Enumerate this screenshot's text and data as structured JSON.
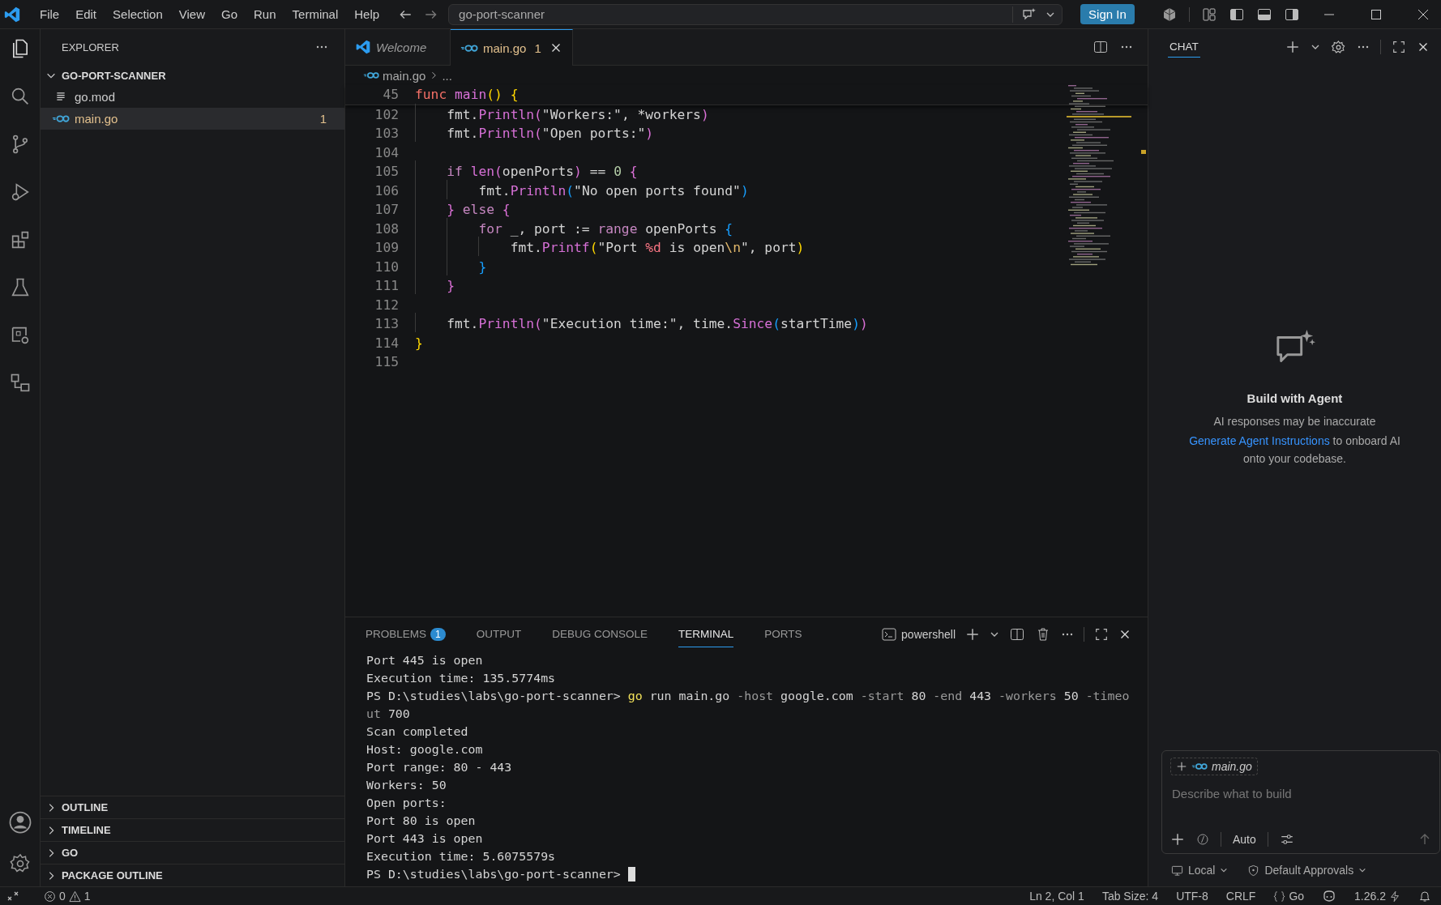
{
  "menu": [
    "File",
    "Edit",
    "Selection",
    "View",
    "Go",
    "Run",
    "Terminal",
    "Help"
  ],
  "search": {
    "value": "go-port-scanner"
  },
  "sign_in": "Sign In",
  "explorer": {
    "title": "EXPLORER",
    "folder": "GO-PORT-SCANNER",
    "expanded": true,
    "files": [
      {
        "name": "go.mod",
        "kind": "mod",
        "selected": false,
        "warning": false
      },
      {
        "name": "main.go",
        "kind": "go",
        "selected": true,
        "warning": true,
        "badge": "1"
      }
    ]
  },
  "sections": [
    {
      "label": "OUTLINE",
      "expanded": false
    },
    {
      "label": "TIMELINE",
      "expanded": false
    },
    {
      "label": "GO",
      "expanded": false
    },
    {
      "label": "PACKAGE OUTLINE",
      "expanded": false
    }
  ],
  "tabs": [
    {
      "label": "Welcome",
      "kind": "welcome",
      "selected": false,
      "preview": true,
      "warning": false
    },
    {
      "label": "main.go",
      "kind": "go",
      "selected": true,
      "preview": false,
      "warning": true,
      "badge": "1"
    }
  ],
  "breadcrumb": [
    "main.go",
    "..."
  ],
  "sticky": {
    "number": "45",
    "tokens": [
      {
        "t": "func",
        "color": "#f47067"
      },
      {
        "t": " main",
        "color": "#d670d6"
      },
      {
        "t": "()",
        "color": "#ffd700"
      },
      {
        "t": " {",
        "color": "#ffd700"
      }
    ]
  },
  "code": [
    {
      "number": "102",
      "tokens": [
        {
          "t": "    fmt."
        },
        {
          "t": "Println",
          "color": "#d670d6"
        },
        {
          "t": "(",
          "color": "#da70d6"
        },
        {
          "t": "\"Workers:\", *workers"
        },
        {
          "t": ")",
          "color": "#da70d6"
        }
      ]
    },
    {
      "number": "103",
      "tokens": [
        {
          "t": "    fmt."
        },
        {
          "t": "Println",
          "color": "#d670d6"
        },
        {
          "t": "(",
          "color": "#da70d6"
        },
        {
          "t": "\"Open ports:\""
        },
        {
          "t": ")",
          "color": "#da70d6"
        }
      ]
    },
    {
      "number": "104"
    },
    {
      "number": "105",
      "tokens": [
        {
          "t": "    if",
          "color": "#c586c0"
        },
        {
          "t": " len",
          "color": "#d670d6"
        },
        {
          "t": "(",
          "color": "#da70d6"
        },
        {
          "t": "openPorts"
        },
        {
          "t": ")",
          "color": "#da70d6"
        },
        {
          "t": " =="
        },
        {
          "t": " 0",
          "color": "#b5cea8"
        },
        {
          "t": " {",
          "color": "#da70d6"
        }
      ]
    },
    {
      "number": "106",
      "tokens": [
        {
          "t": "        fmt."
        },
        {
          "t": "Println",
          "color": "#d670d6"
        },
        {
          "t": "(",
          "color": "#179fff"
        },
        {
          "t": "\"No open ports found\""
        },
        {
          "t": ")",
          "color": "#179fff"
        }
      ]
    },
    {
      "number": "107",
      "tokens": [
        {
          "t": "    }",
          "color": "#da70d6"
        },
        {
          "t": " else",
          "color": "#c586c0"
        },
        {
          "t": " {",
          "color": "#da70d6"
        }
      ]
    },
    {
      "number": "108",
      "tokens": [
        {
          "t": "        for",
          "color": "#c586c0"
        },
        {
          "t": " _, port :="
        },
        {
          "t": " range",
          "color": "#c586c0"
        },
        {
          "t": " openPorts"
        },
        {
          "t": " {",
          "color": "#179fff"
        }
      ]
    },
    {
      "number": "109",
      "tokens": [
        {
          "t": "            fmt."
        },
        {
          "t": "Printf",
          "color": "#d670d6"
        },
        {
          "t": "(",
          "color": "#ffd700"
        },
        {
          "t": "\"Port"
        },
        {
          "t": " %d",
          "color": "#f97583"
        },
        {
          "t": " is open"
        },
        {
          "t": "\\n",
          "color": "#e2b86b"
        },
        {
          "t": "\", port"
        },
        {
          "t": ")",
          "color": "#ffd700"
        }
      ]
    },
    {
      "number": "110",
      "tokens": [
        {
          "t": "        }",
          "color": "#179fff"
        }
      ]
    },
    {
      "number": "111",
      "tokens": [
        {
          "t": "    }",
          "color": "#da70d6"
        }
      ]
    },
    {
      "number": "112"
    },
    {
      "number": "113",
      "tokens": [
        {
          "t": "    fmt."
        },
        {
          "t": "Println",
          "color": "#d670d6"
        },
        {
          "t": "(",
          "color": "#da70d6"
        },
        {
          "t": "\"Execution time:\", time."
        },
        {
          "t": "Since",
          "color": "#d670d6"
        },
        {
          "t": "(",
          "color": "#179fff"
        },
        {
          "t": "startTime"
        },
        {
          "t": ")",
          "color": "#179fff"
        },
        {
          "t": ")",
          "color": "#da70d6"
        }
      ]
    },
    {
      "number": "114",
      "tokens": [
        {
          "t": "}",
          "color": "#ffd700"
        }
      ]
    },
    {
      "number": "115"
    }
  ],
  "panel_tabs": [
    {
      "label": "PROBLEMS",
      "badge": "1",
      "selected": false
    },
    {
      "label": "OUTPUT",
      "selected": false
    },
    {
      "label": "DEBUG CONSOLE",
      "selected": false
    },
    {
      "label": "TERMINAL",
      "selected": true
    },
    {
      "label": "PORTS",
      "selected": false
    }
  ],
  "terminal": {
    "shell": "powershell",
    "lines": [
      [
        {
          "t": "Port 445 is open"
        }
      ],
      [
        {
          "t": "Execution time: 135.5774ms"
        }
      ],
      [
        {
          "t": "PS D:\\studies\\labs\\go-port-scanner>"
        },
        {
          "t": " go",
          "color": "#f1e05a"
        },
        {
          "t": " run main.go"
        },
        {
          "t": " -host",
          "color": "#9a9a9a"
        },
        {
          "t": " google.com"
        },
        {
          "t": " -start",
          "color": "#9a9a9a"
        },
        {
          "t": " 80"
        },
        {
          "t": " -end",
          "color": "#9a9a9a"
        },
        {
          "t": " 443"
        },
        {
          "t": " -workers",
          "color": "#9a9a9a"
        },
        {
          "t": " 50"
        },
        {
          "t": " -timeo",
          "color": "#9a9a9a"
        }
      ],
      [
        {
          "t": "ut",
          "color": "#9a9a9a"
        },
        {
          "t": " 700"
        }
      ],
      [
        {
          "t": "Scan completed"
        }
      ],
      [
        {
          "t": "Host: google.com"
        }
      ],
      [
        {
          "t": "Port range: 80 - 443"
        }
      ],
      [
        {
          "t": "Workers: 50"
        }
      ],
      [
        {
          "t": "Open ports:"
        }
      ],
      [
        {
          "t": "Port 80 is open"
        }
      ],
      [
        {
          "t": "Port 443 is open"
        }
      ],
      [
        {
          "t": "Execution time: 5.6075579s"
        }
      ],
      [
        {
          "t": "PS D:\\studies\\labs\\go-port-scanner>"
        }
      ]
    ]
  },
  "chat": {
    "title": "CHAT",
    "heading": "Build with Agent",
    "note": "AI responses may be inaccurate",
    "link": "Generate Agent Instructions",
    "after_link": " to onboard AI onto your codebase.",
    "attachment": "main.go",
    "placeholder": "Describe what to build",
    "mode": "Auto",
    "target": "Local",
    "approvals": "Default Approvals"
  },
  "status": {
    "errors": "0",
    "warnings": "1",
    "items": [
      "Ln 2, Col 1",
      "Tab Size: 4",
      "UTF-8",
      "CRLF"
    ],
    "language": "Go",
    "version": "1.26.2"
  }
}
